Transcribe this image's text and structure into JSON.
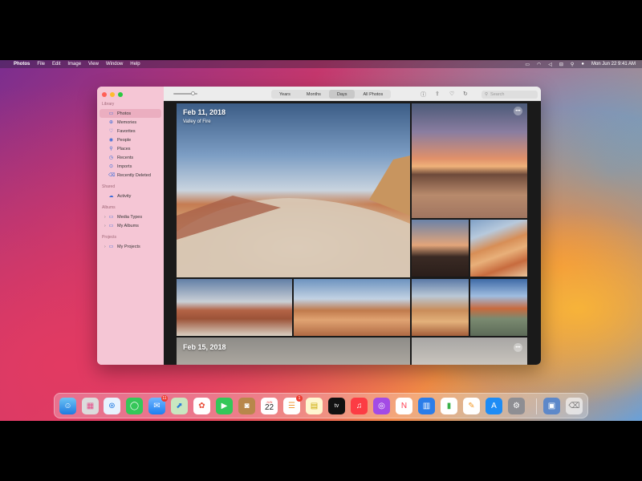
{
  "menubar": {
    "apple": "",
    "app": "Photos",
    "items": [
      "File",
      "Edit",
      "Image",
      "View",
      "Window",
      "Help"
    ],
    "clock": "Mon Jun 22  9:41 AM"
  },
  "sidebar": {
    "library_header": "Library",
    "library": [
      {
        "label": "Photos",
        "icon": "photos-icon",
        "glyph": "▭"
      },
      {
        "label": "Memories",
        "icon": "memories-icon",
        "glyph": "⊕"
      },
      {
        "label": "Favorites",
        "icon": "heart-icon",
        "glyph": "♡"
      },
      {
        "label": "People",
        "icon": "person-icon",
        "glyph": "◉"
      },
      {
        "label": "Places",
        "icon": "pin-icon",
        "glyph": "⚲"
      },
      {
        "label": "Recents",
        "icon": "clock-icon",
        "glyph": "◷"
      },
      {
        "label": "Imports",
        "icon": "import-icon",
        "glyph": "⊙"
      },
      {
        "label": "Recently Deleted",
        "icon": "trash-icon",
        "glyph": "⌫"
      }
    ],
    "shared_header": "Shared",
    "shared": [
      {
        "label": "Activity",
        "icon": "cloud-icon",
        "glyph": "☁"
      }
    ],
    "albums_header": "Albums",
    "albums": [
      {
        "label": "Media Types",
        "icon": "folder-icon",
        "glyph": "▭"
      },
      {
        "label": "My Albums",
        "icon": "folder-icon",
        "glyph": "▭"
      }
    ],
    "projects_header": "Projects",
    "projects": [
      {
        "label": "My Projects",
        "icon": "folder-icon",
        "glyph": "▭"
      }
    ]
  },
  "toolbar": {
    "tabs": [
      "Years",
      "Months",
      "Days",
      "All Photos"
    ],
    "selected_tab": "Days",
    "search_placeholder": "Search"
  },
  "content": {
    "group1_date": "Feb 11, 2018",
    "group1_place": "Valley of Fire",
    "group2_date": "Feb 15, 2018",
    "more_glyph": "•••"
  },
  "dock": {
    "mail_badge": "11",
    "reminders_badge": "1",
    "calendar_month": "JUN",
    "calendar_day": "22",
    "tv_label": "tv"
  },
  "colors": {
    "sidebar_bg": "#f5c6d5",
    "accent": "#3b6bd8"
  }
}
